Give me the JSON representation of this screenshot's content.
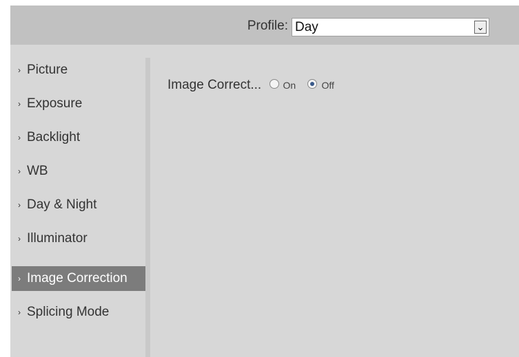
{
  "header": {
    "profile_label": "Profile",
    "profile_value": "Day"
  },
  "sidebar": {
    "items": [
      {
        "label": "Picture"
      },
      {
        "label": "Exposure"
      },
      {
        "label": "Backlight"
      },
      {
        "label": "WB"
      },
      {
        "label": "Day & Night"
      },
      {
        "label": "Illuminator"
      },
      {
        "label": "Image Correction"
      },
      {
        "label": "Splicing Mode"
      }
    ],
    "active": "Image Correction"
  },
  "main": {
    "field_label": "Image Correct...",
    "option_on": "On",
    "option_off": "Off",
    "selected": "Off"
  }
}
